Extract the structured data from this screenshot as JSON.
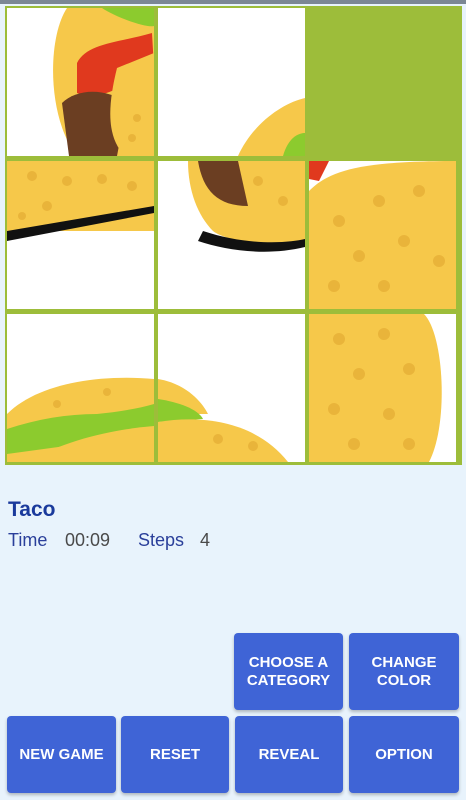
{
  "puzzle": {
    "name": "Taco",
    "time_label": "Time",
    "time_value": "00:09",
    "steps_label": "Steps",
    "steps_value": "4",
    "colors": {
      "board_frame": "#9dbd3a",
      "shell": "#f6c84a",
      "shell_edge": "#e8a62a",
      "dots": "#e9b43a",
      "lettuce": "#8ccb2e",
      "tomato": "#e0391e",
      "meat": "#6b3e22"
    }
  },
  "buttons": {
    "choose_category": "CHOOSE A CATEGORY",
    "change_color": "CHANGE COLOR",
    "new_game": "NEW GAME",
    "reset": "RESET",
    "reveal": "REVEAL",
    "option": "OPTION",
    "accent": "#3f64d6"
  }
}
